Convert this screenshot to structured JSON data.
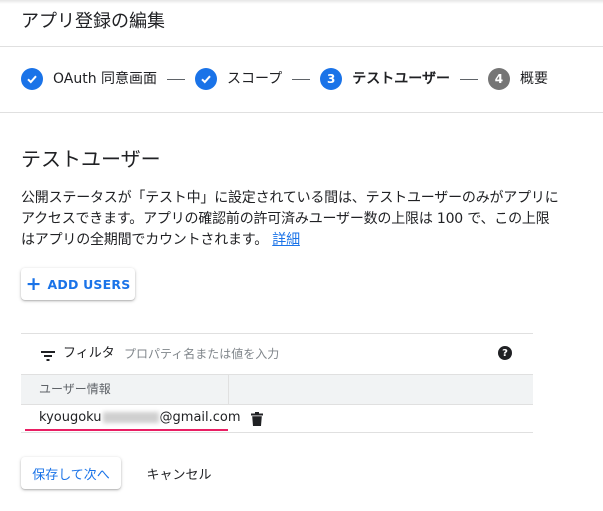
{
  "page": {
    "title": "アプリ登録の編集"
  },
  "stepper": {
    "steps": [
      {
        "number": "1",
        "label": "OAuth 同意画面",
        "status": "completed"
      },
      {
        "number": "2",
        "label": "スコープ",
        "status": "completed"
      },
      {
        "number": "3",
        "label": "テストユーザー",
        "status": "current"
      },
      {
        "number": "4",
        "label": "概要",
        "status": "upcoming"
      }
    ],
    "separator": "—"
  },
  "section": {
    "heading": "テストユーザー",
    "description": "公開ステータスが「テスト中」に設定されている間は、テストユーザーのみがアプリにアクセスできます。アプリの確認前の許可済みユーザー数の上限は 100 で、この上限はアプリの全期間でカウントされます。",
    "details_link": "詳細"
  },
  "add_users": {
    "icon": "plus-icon",
    "label": "ADD USERS"
  },
  "table": {
    "filter_label": "フィルタ",
    "filter_placeholder": "プロパティ名または値を入力",
    "columns": [
      "ユーザー情報",
      ""
    ],
    "rows": [
      {
        "email_prefix": "kyougoku",
        "email_suffix": "gmail.com",
        "action_icon": "trash-icon"
      }
    ]
  },
  "actions": {
    "save_next": "保存して次へ",
    "cancel": "キャンセル"
  },
  "colors": {
    "accent": "#1a73e8",
    "step_upcoming": "#757575",
    "highlight_underline": "#e91e63"
  }
}
